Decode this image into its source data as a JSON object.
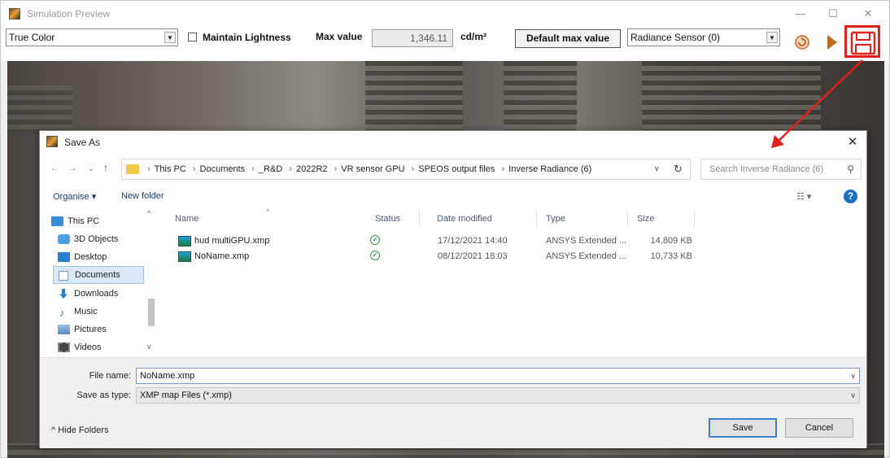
{
  "window": {
    "title": "Simulation Preview",
    "controls": {
      "minimize": "—",
      "maximize": "☐",
      "close": "✕"
    }
  },
  "toolbar": {
    "color_mode": "True Color",
    "maintain_lightness_label": "Maintain Lightness",
    "maintain_lightness_checked": false,
    "max_value_label": "Max value",
    "max_value": "1,346.11",
    "unit": "cd/m²",
    "default_max_button": "Default max value",
    "sensor": "Radiance Sensor (0)",
    "icons": [
      "refresh-icon",
      "play-icon",
      "save-icon"
    ],
    "accent_highlight": "#e0211b"
  },
  "dialog": {
    "title": "Save As",
    "close": "✕",
    "nav": {
      "back": "←",
      "forward": "→",
      "recent": "⌄",
      "up": "↑"
    },
    "breadcrumbs": [
      "This PC",
      "Documents",
      "_R&D",
      "2022R2",
      "VR sensor GPU",
      "SPEOS output files",
      "Inverse Radiance (6)"
    ],
    "search_placeholder": "Search Inverse Radiance (6)",
    "commands": {
      "organise": "Organise ▾",
      "new_folder": "New folder"
    },
    "nav_pane": [
      {
        "label": "This PC",
        "icon": "pc-icon",
        "color": "#3a8bd8"
      },
      {
        "label": "3D Objects",
        "icon": "objects-3d-icon",
        "color": "#4aa3e0"
      },
      {
        "label": "Desktop",
        "icon": "desktop-icon",
        "color": "#2a7fd0"
      },
      {
        "label": "Documents",
        "icon": "documents-icon",
        "color": "#b8c8d8",
        "selected": true
      },
      {
        "label": "Downloads",
        "icon": "downloads-icon",
        "color": "#2a7fd0"
      },
      {
        "label": "Music",
        "icon": "music-icon",
        "color": "#2a6fd0"
      },
      {
        "label": "Pictures",
        "icon": "pictures-icon",
        "color": "#6a9ad0"
      },
      {
        "label": "Videos",
        "icon": "videos-icon",
        "color": "#444"
      }
    ],
    "columns": {
      "name": "Name",
      "status": "Status",
      "date": "Date modified",
      "type": "Type",
      "size": "Size"
    },
    "files": [
      {
        "name": "hud multiGPU.xmp",
        "status": "✓",
        "date": "17/12/2021 14:40",
        "type": "ANSYS Extended ...",
        "size": "14,809 KB"
      },
      {
        "name": "NoName.xmp",
        "status": "✓",
        "date": "08/12/2021 18:03",
        "type": "ANSYS Extended ...",
        "size": "10,733 KB"
      }
    ],
    "file_name_label": "File name:",
    "file_name": "NoName.xmp",
    "save_type_label": "Save as type:",
    "save_type": "XMP map Files (*.xmp)",
    "hide_folders": "^  Hide Folders",
    "save_button": "Save",
    "cancel_button": "Cancel"
  }
}
